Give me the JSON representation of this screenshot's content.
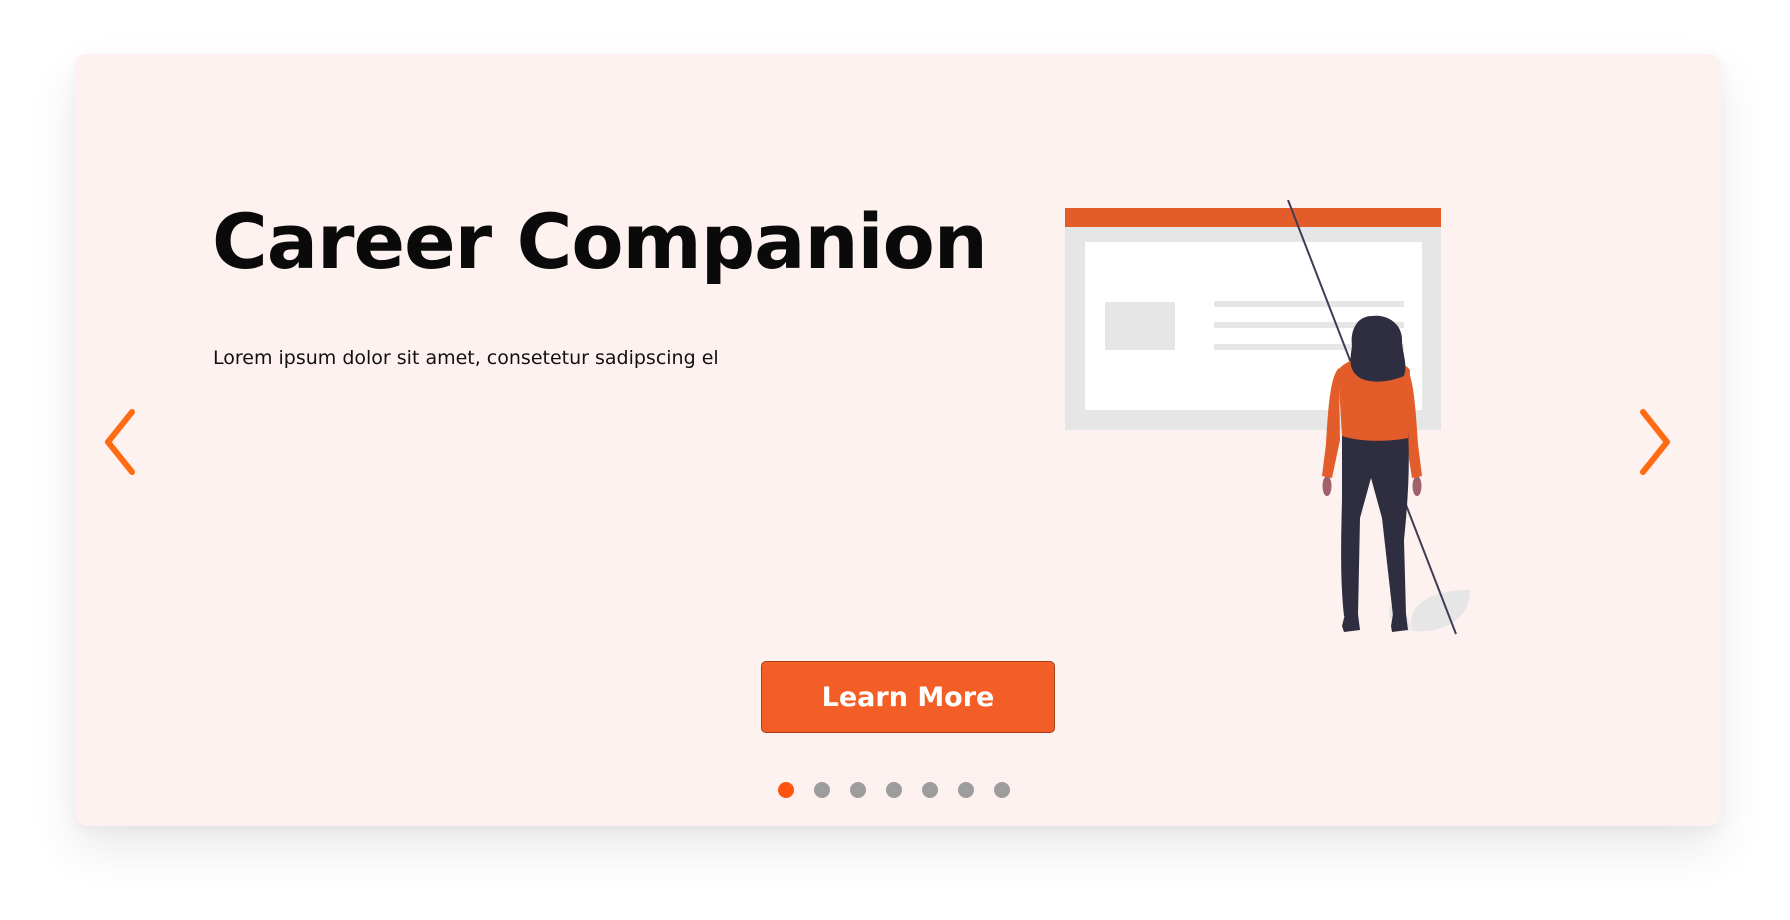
{
  "slide": {
    "title": "Career Companion",
    "description": "Lorem ipsum dolor sit amet, consetetur sadipscing el",
    "cta_label": "Learn More"
  },
  "navigation": {
    "prev_icon": "chevron-left-icon",
    "next_icon": "chevron-right-icon"
  },
  "pagination": {
    "total": 7,
    "active_index": 0
  },
  "colors": {
    "card_background": "#fdf2ef",
    "accent": "#f35d26",
    "arrow": "#ff6a13",
    "dot_active": "#ff5412",
    "dot_inactive": "#9d9d9d"
  }
}
